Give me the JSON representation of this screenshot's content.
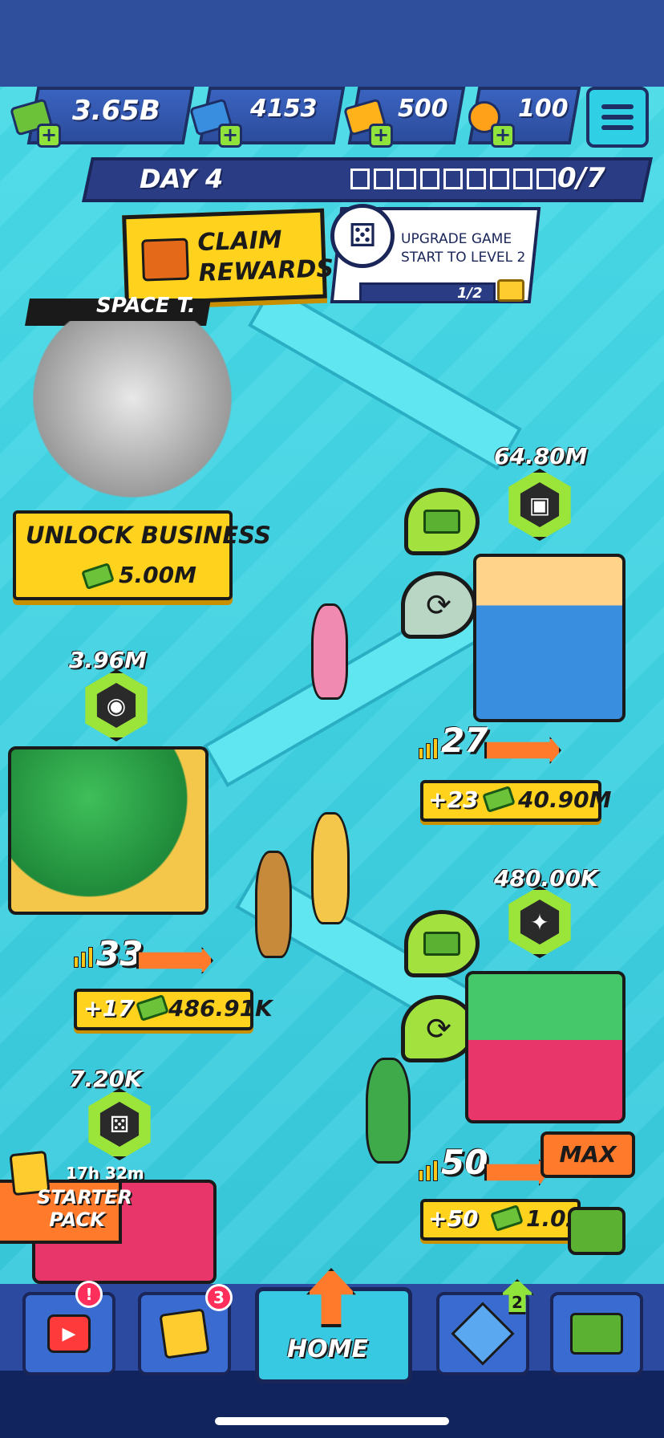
{
  "resources": {
    "cash": "3.65B",
    "gems": "4153",
    "gold": "500",
    "coins": "100"
  },
  "day": {
    "label": "DAY 4",
    "progress": "0/7",
    "progress_value": 0,
    "progress_total": 7
  },
  "claim": {
    "label_line1": "CLAIM",
    "label_line2": "REWARDS"
  },
  "quest": {
    "text": "UPGRADE GAME START TO LEVEL 2",
    "progress": "1/2"
  },
  "locked_business": {
    "banner": "SPACE T.",
    "unlock_label": "UNLOCK BUSINESS",
    "unlock_price": "5.00M"
  },
  "businesses": [
    {
      "name": "shipping",
      "value": "64.80M",
      "level": "27",
      "plus": "+23",
      "earn": "40.90M"
    },
    {
      "name": "tiger",
      "value": "3.96M",
      "level": "33",
      "plus": "+17",
      "earn": "486.91K"
    },
    {
      "name": "dino",
      "value": "480.00K",
      "level": "50",
      "plus": "+50",
      "earn": "1.02M",
      "max_label": "MAX"
    },
    {
      "name": "game-start",
      "value": "7.20K"
    }
  ],
  "starter_pack": {
    "timer": "17h 32m",
    "label": "STARTER PACK"
  },
  "nav": {
    "video_badge": "!",
    "cards_badge": "3",
    "home_label": "HOME",
    "upgrades_badge": "2"
  },
  "colors": {
    "accent_yellow": "#ffd21e",
    "accent_green": "#9be43a",
    "accent_orange": "#ff7a2a",
    "nav_blue": "#2b4aa0"
  }
}
